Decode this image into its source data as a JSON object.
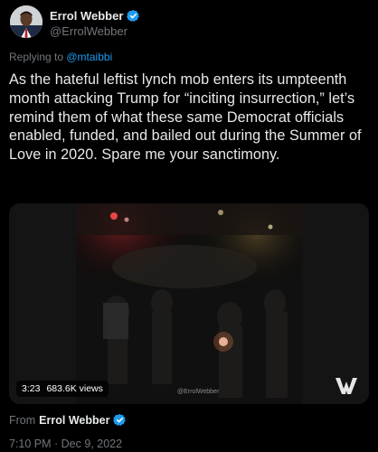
{
  "author": {
    "name": "Errol Webber",
    "handle": "@ErrolWebber",
    "verified": true,
    "avatar_icon": "profile-photo"
  },
  "replying": {
    "prefix": "Replying to ",
    "mention": "@mtaibbi"
  },
  "tweet": {
    "text": "As the hateful leftist lynch mob enters its umpteenth month attacking Trump for “inciting insurrection,” let’s remind them of what these same Democrat officials enabled, funded, and bailed out during the Summer of Love in 2020. Spare me your sanctimony."
  },
  "media": {
    "duration": "3:23",
    "views": "683.6K views",
    "watermark": "@ErrolWebber",
    "logo_icon": "w-logo-icon"
  },
  "source": {
    "prefix": "From",
    "name": "Errol Webber"
  },
  "timestamp": "7:10 PM · Dec 9, 2022",
  "colors": {
    "background": "#000000",
    "text": "#e7e9ea",
    "muted": "#71767b",
    "accent": "#1d9bf0"
  }
}
